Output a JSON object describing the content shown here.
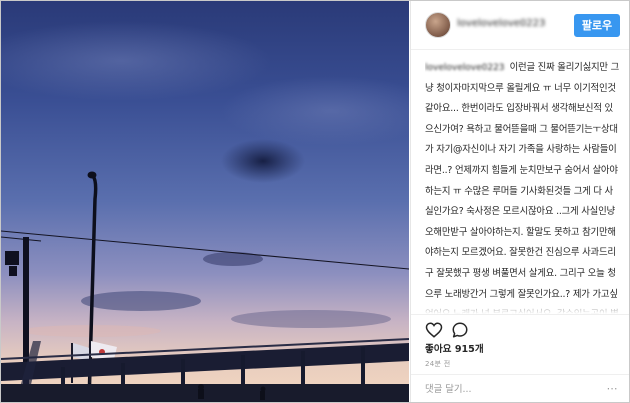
{
  "post": {
    "username": "lovelovelove0223",
    "follow_label": "팔로우",
    "caption": "이런글 진짜 올리기싫지만 그냥 청이자마지막으루 올릴게요 ㅠ 너무 이기적인것같아요... 한번이라도 입장바꿔서 생각해보신적 있으신가여? 욕하고 물어뜯을때 그 물어뜯기는ㅜ상대가 자기@자신이나 자기 가족을 사랑하는 사람들이라면..? 언제까지 힘들게 눈치만보구 숨어서 살아야하는지 ㅠ 수많은 루머들 기사화된것들 그게 다 사실인가요? 숙사정은 모르시잖아요 ..그게 사실인냥 오해만받구 살아야하는지. 할말도 못하고 참기만해야하는지 모르겠어요. 잘못한건 진심으루 사과드리구 잘못했구 평생 벼풀면서 살게요. 그리구 오늘 청으루 노래방간거 그렇게 잘못인가요..? 제가 가고싶었어요 노래가 넘 부르고싶어서요..갈수있는곳이 별로 없잖아요. 솔직히 지나다니면 수근거리구 사진찍구.. 근데 너무 몰아가면서 사람 상처주고 못살게하는건 정말 아닌것같아요 ㅠ 제가 잘못한게 있다면 사과드리구 욕하셔도좋아요.",
    "likes": "좋아요 915개",
    "time": "24분 전",
    "comment_placeholder": "댓글 달기..."
  },
  "icons": {
    "like": "heart-icon",
    "comment": "comment-icon",
    "more": "more-options-icon"
  },
  "colors": {
    "accent": "#3897f0",
    "text": "#262626",
    "muted": "#999999"
  }
}
